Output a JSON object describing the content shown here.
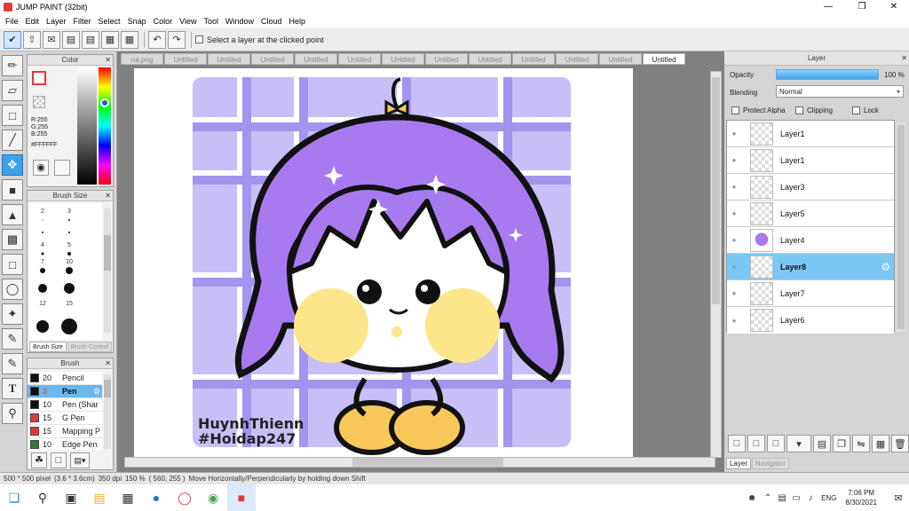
{
  "window": {
    "title": "JUMP PAINT (32bit)"
  },
  "menu": [
    "File",
    "Edit",
    "Layer",
    "Filter",
    "Select",
    "Snap",
    "Color",
    "View",
    "Tool",
    "Window",
    "Cloud",
    "Help"
  ],
  "toolbar": {
    "select_layer_label": "Select a layer at the clicked point"
  },
  "color_panel": {
    "title": "Color",
    "r": "R:255",
    "g": "G:255",
    "b": "B:255",
    "hex": "#FFFFFF"
  },
  "brush_size_panel": {
    "title": "Brush Size",
    "tab_active": "Brush Size",
    "tab_inactive": "Brush Control",
    "sizes": [
      "2",
      "3",
      "4",
      "5",
      "7",
      "10",
      "12",
      "15"
    ]
  },
  "brush_panel": {
    "title": "Brush",
    "items": [
      {
        "size": "20",
        "name": "Pencil",
        "color": "#111111"
      },
      {
        "size": "3",
        "name": "Pen",
        "color": "#111111"
      },
      {
        "size": "10",
        "name": "Pen (Shar",
        "color": "#111111"
      },
      {
        "size": "15",
        "name": "G Pen",
        "color": "#e53935"
      },
      {
        "size": "15",
        "name": "Mapping P",
        "color": "#e53935"
      },
      {
        "size": "10",
        "name": "Edge Pen",
        "color": "#2e7d32"
      }
    ]
  },
  "tabs": [
    "na.png",
    "Untitled",
    "Untitled",
    "Untitled",
    "Untitled",
    "Untitled",
    "Untitled",
    "Untitled",
    "Untitled",
    "Untitled",
    "Untitled",
    "Untitled",
    "Untitled"
  ],
  "artwork": {
    "watermark_line1": "HuynhThienn",
    "watermark_line2": "#Hoidap247"
  },
  "layer_panel": {
    "title": "Layer",
    "opacity_label": "Opacity",
    "opacity_value": "100 %",
    "blending_label": "Blending",
    "blending_value": "Normal",
    "protect_alpha": "Protect Alpha",
    "clipping": "Clipping",
    "lock": "Lock",
    "layers": [
      "Layer1",
      "Layer1",
      "Layer3",
      "Layer5",
      "Layer4",
      "Layer8",
      "Layer7",
      "Layer6"
    ],
    "selected_index": 5,
    "tab_active": "Layer",
    "tab_inactive": "Navigator"
  },
  "status": {
    "size": "500 * 500 pixel",
    "cm": "(3.6 * 3.6cm)",
    "dpi": "350 dpi",
    "zoom": "150 %",
    "coords": "( 560, 255 )",
    "hint": "Move Horizontally/Perpendicularly by holding down Shift"
  },
  "taskbar": {
    "lang": "ENG",
    "time": "7:06 PM",
    "date": "8/30/2021"
  },
  "colors": {
    "accent": "#3ea2e8",
    "selected_layer": "#79c8f5",
    "hair": "#a77bef",
    "background_purple": "#c8bff7"
  }
}
